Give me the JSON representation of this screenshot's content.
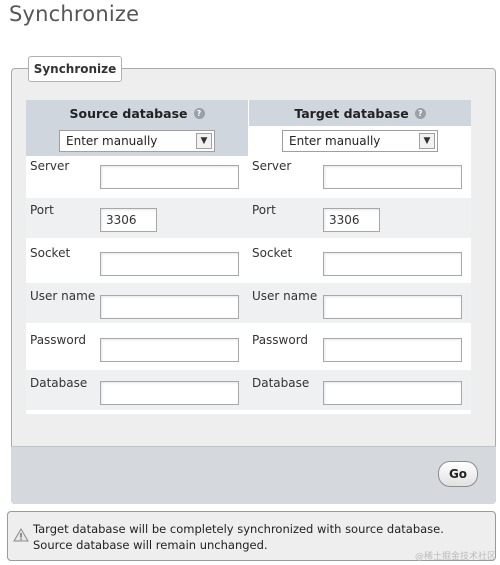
{
  "page": {
    "title": "Synchronize"
  },
  "panel": {
    "legend": "Synchronize"
  },
  "source": {
    "heading": "Source database",
    "method": "Enter manually",
    "port_value": "3306"
  },
  "target": {
    "heading": "Target database",
    "method": "Enter manually",
    "port_value": "3306"
  },
  "labels": {
    "server": "Server",
    "port": "Port",
    "socket": "Socket",
    "username": "User name",
    "password": "Password",
    "database": "Database"
  },
  "actions": {
    "go_label": "Go"
  },
  "notice": {
    "text": "Target database will be completely synchronized with source database. Source database will remain unchanged."
  },
  "watermark": "@稀土掘金技术社区",
  "icons": {
    "help": "help-icon",
    "dropdown": "chevron-down-icon",
    "notice": "warning-icon"
  }
}
